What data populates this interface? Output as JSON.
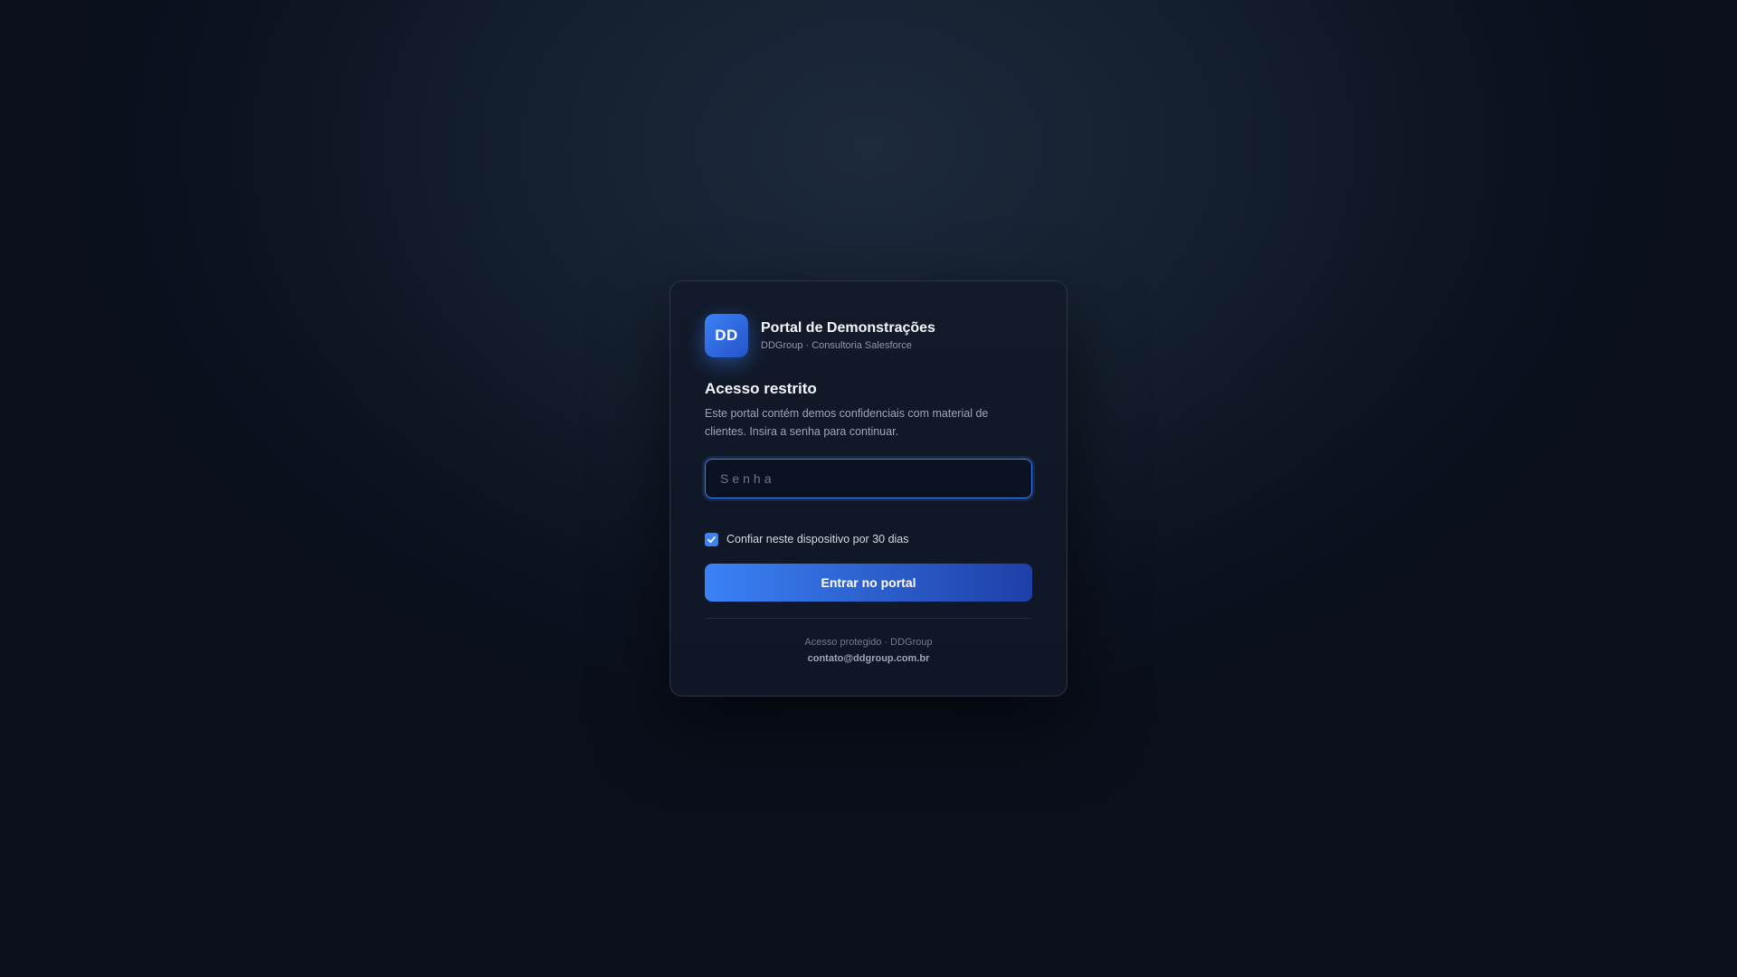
{
  "brand": {
    "logo_text": "DD",
    "title": "Portal de Demonstrações",
    "subtitle": "DDGroup · Consultoria Salesforce"
  },
  "access": {
    "heading": "Acesso restrito",
    "description": "Este portal contém demos confidenciais com material de clientes. Insira a senha para continuar."
  },
  "form": {
    "password_placeholder": "Senha",
    "password_value": "",
    "trust_device_label": "Confiar neste dispositivo por 30 dias",
    "trust_device_checked": true,
    "submit_label": "Entrar no portal"
  },
  "footer": {
    "protected_text": "Acesso protegido · DDGroup",
    "email": "contato@ddgroup.com.br"
  },
  "colors": {
    "accent": "#3b82f6",
    "accent_dark": "#1e3fa6",
    "background": "#0c1220",
    "card": "#111a2a"
  },
  "icons": {
    "checkbox": "checkmark-icon"
  }
}
